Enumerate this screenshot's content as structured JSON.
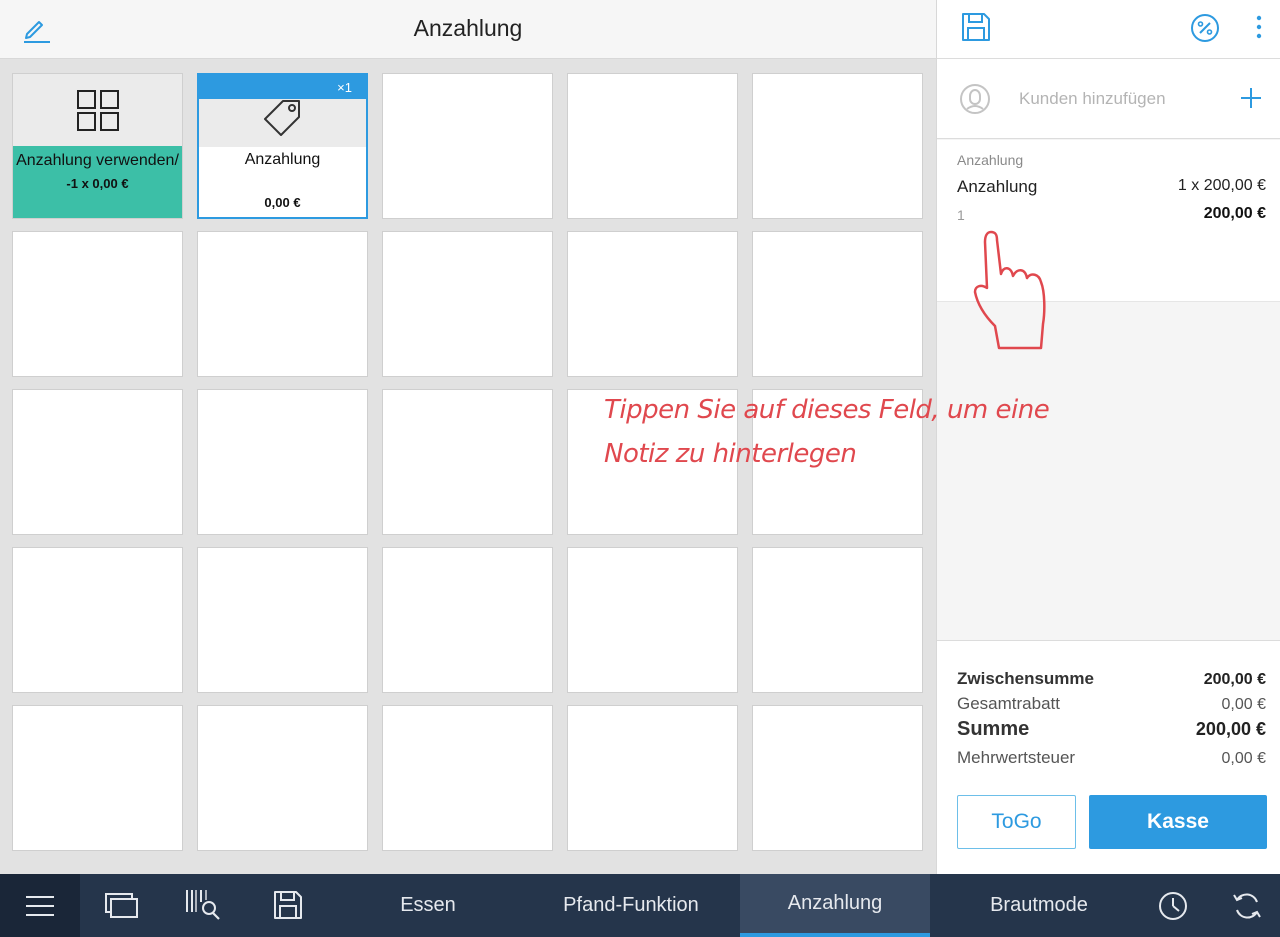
{
  "header": {
    "title": "Anzahlung"
  },
  "grid": {
    "folder_tile": {
      "name": "Anzahlung verwenden/",
      "qty_price": "-1 x 0,00 €"
    },
    "selected_tile": {
      "badge": "×1",
      "name": "Anzahlung",
      "price": "0,00 €"
    }
  },
  "customer": {
    "placeholder": "Kunden hinzufügen"
  },
  "cart": {
    "items": [
      {
        "group": "Anzahlung",
        "name": "Anzahlung",
        "qty_price": "1 x 200,00 €",
        "position": "1",
        "total": "200,00 €"
      }
    ]
  },
  "totals": {
    "subtotal_label": "Zwischensumme",
    "subtotal": "200,00 €",
    "discount_label": "Gesamtrabatt",
    "discount": "0,00 €",
    "sum_label": "Summe",
    "sum": "200,00 €",
    "vat_label": "Mehrwertsteuer",
    "vat": "0,00 €"
  },
  "actions": {
    "togo": "ToGo",
    "checkout": "Kasse"
  },
  "bottom_nav": {
    "tabs": [
      {
        "label": "Essen"
      },
      {
        "label": "Pfand-Funktion"
      },
      {
        "label": "Anzahlung",
        "active": true
      },
      {
        "label": "Brautmode"
      }
    ]
  },
  "annotation": {
    "line1": "Tippen Sie auf dieses Feld, um eine",
    "line2": "Notiz zu hinterlegen"
  },
  "colors": {
    "accent": "#2d9ae0",
    "folder_green": "#3cbfa7",
    "nav_bg": "#25354b",
    "annotation_red": "#e0484e"
  },
  "icons": [
    "edit-icon",
    "grid-icon",
    "tag-icon",
    "save-icon",
    "discount-icon",
    "more-icon",
    "person-icon",
    "plus-icon",
    "hand-pointer-icon",
    "menu-icon",
    "screens-icon",
    "barcode-search-icon",
    "clock-icon",
    "sync-icon"
  ]
}
